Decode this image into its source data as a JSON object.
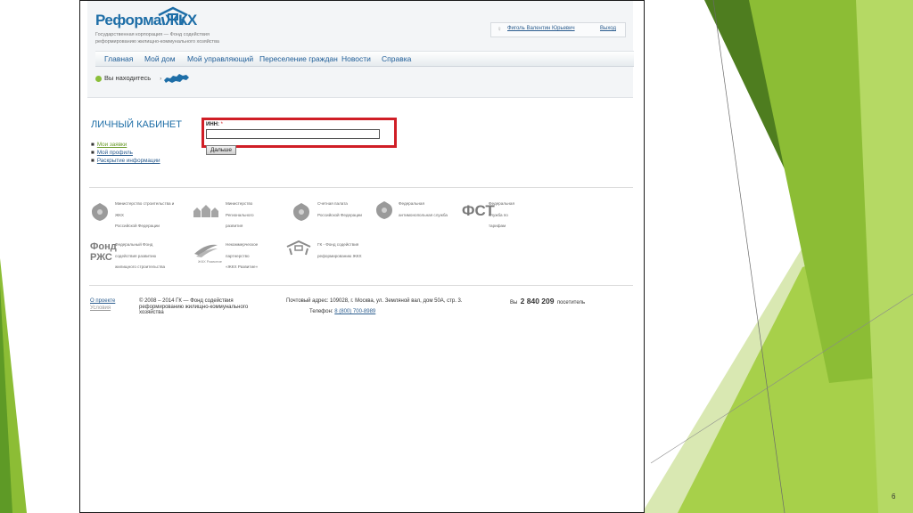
{
  "header": {
    "logo_text": "Реформа ЖКХ",
    "corp_line1": "Государственная корпорация — Фонд содействия",
    "corp_line2": "реформированию жилищно-коммунального хозяйства",
    "user_name": "Фиголь Валентин Юрьевич",
    "logout": "Выход"
  },
  "nav": {
    "items": [
      "Главная",
      "Мой дом",
      "Мой управляющий",
      "Переселение граждан",
      "Новости",
      "Справка"
    ]
  },
  "breadcrumb": {
    "label": "Вы находитесь"
  },
  "cabinet": {
    "title": "ЛИЧНЫЙ КАБИНЕТ",
    "menu": [
      "Мои заявки",
      "Мой профиль",
      "Раскрытие информации"
    ]
  },
  "form": {
    "inn_label": "ИНН:",
    "required_mark": "*",
    "inn_value": "",
    "next_button": "Дальше"
  },
  "partners": [
    {
      "lines": [
        "Министерство строительства и",
        "ЖКХ",
        "Российской Федерации"
      ]
    },
    {
      "lines": [
        "Министерство",
        "Регионального",
        "развития"
      ]
    },
    {
      "lines": [
        "Счетная палата",
        "Российской Федерации"
      ]
    },
    {
      "lines": [
        "Федеральная",
        "антимонопольная служба"
      ]
    },
    {
      "logo": "ФСТ",
      "lines": [
        "Федеральная",
        "служба по",
        "тарифам"
      ]
    },
    {
      "logo1": "Фонд",
      "logo2": "РЖС",
      "lines": [
        "Федеральный Фонд",
        "содействия развитию",
        "жилищного строительства"
      ]
    },
    {
      "logo": "ЖКХ Развитие",
      "lines": [
        "Некоммерческое",
        "партнерство",
        "«ЖКХ Развитие»"
      ]
    },
    {
      "lines": [
        "ГК - Фонд содействия",
        "реформированию ЖКХ"
      ]
    }
  ],
  "footer": {
    "about": "О проекте",
    "terms": "Условия",
    "copy_line1": "© 2008 – 2014  ГК — Фонд содействия",
    "copy_line2": "реформированию жилищно-коммунального",
    "copy_line3": "хозяйства",
    "address": "Почтовый адрес:  109028, г. Москва, ул. Земляной вал, дом 50А, стр. 3.",
    "phone_label": "Телефон:",
    "phone": "8 (800) 700-8989",
    "visits_prefix": "Вы",
    "visits_number": "2 840 209",
    "visits_suffix": "посетитель"
  },
  "slide_number": "6",
  "colors": {
    "brand_blue": "#1e6ea7",
    "link_blue": "#2a5c8e",
    "highlight_red": "#d01e26",
    "deco_green": "#8cbd35",
    "deco_dark_green": "#4e7d1f"
  }
}
